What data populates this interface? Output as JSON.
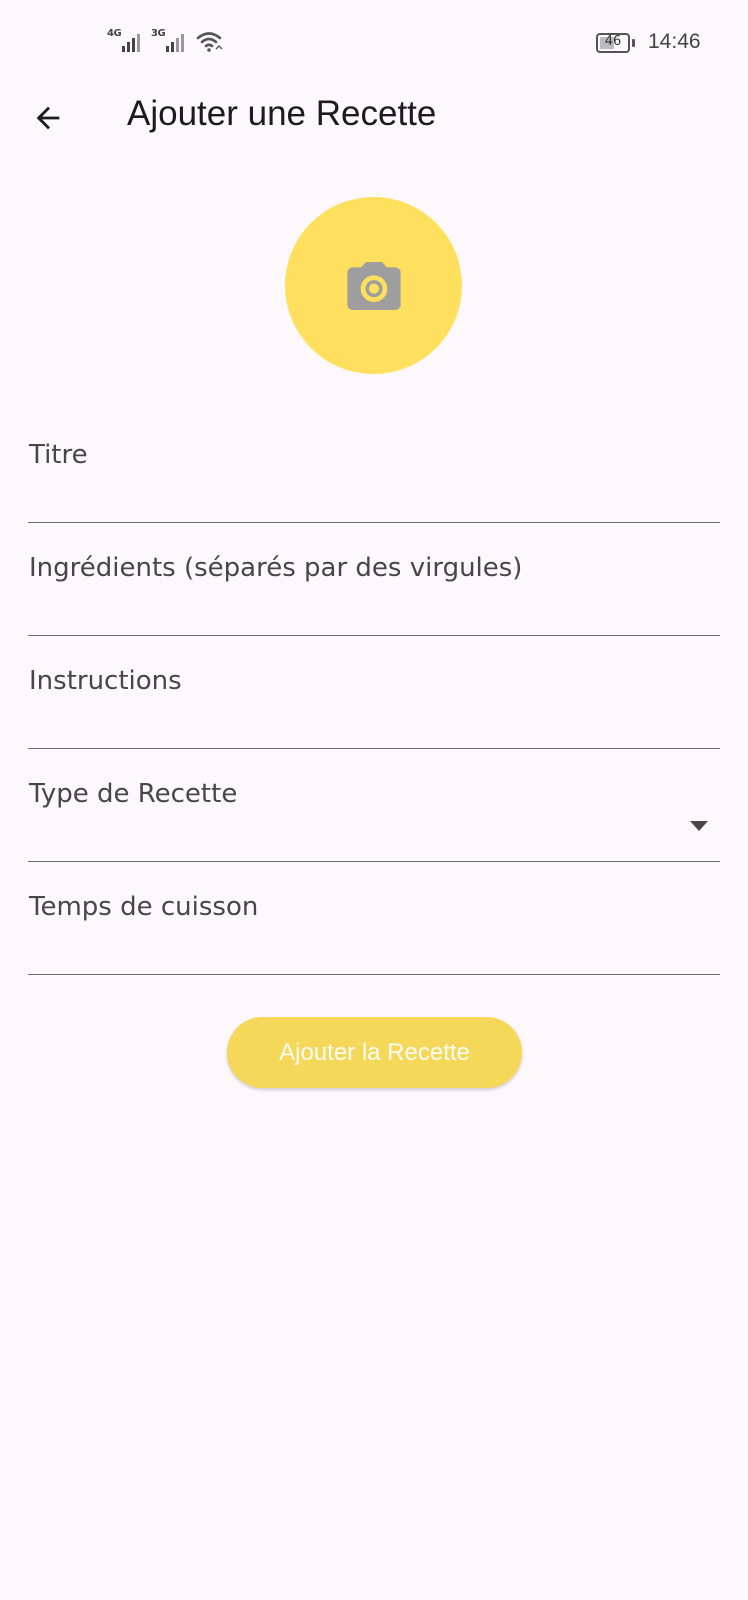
{
  "status_bar": {
    "sim1_tech": "4G",
    "sim2_tech": "3G",
    "battery_level": "46",
    "time": "14:46",
    "icons": [
      "signal-icon",
      "signal-icon",
      "wifi-icon",
      "battery-icon"
    ]
  },
  "app_bar": {
    "back_icon": "arrow-back-icon",
    "title": "Ajouter une Recette"
  },
  "image_picker": {
    "icon": "camera-icon",
    "color": "#fedf5e",
    "icon_color": "#9e9e9e"
  },
  "form": {
    "fields": [
      {
        "label": "Titre",
        "value": ""
      },
      {
        "label": "Ingrédients (séparés par des virgules)",
        "value": ""
      },
      {
        "label": "Instructions",
        "value": ""
      },
      {
        "label": "Type de Recette",
        "value": "",
        "type": "dropdown",
        "icon": "dropdown-arrow-icon"
      },
      {
        "label": "Temps de cuisson",
        "value": ""
      }
    ]
  },
  "submit": {
    "label": "Ajouter la Recette",
    "color": "#f5d75a"
  }
}
